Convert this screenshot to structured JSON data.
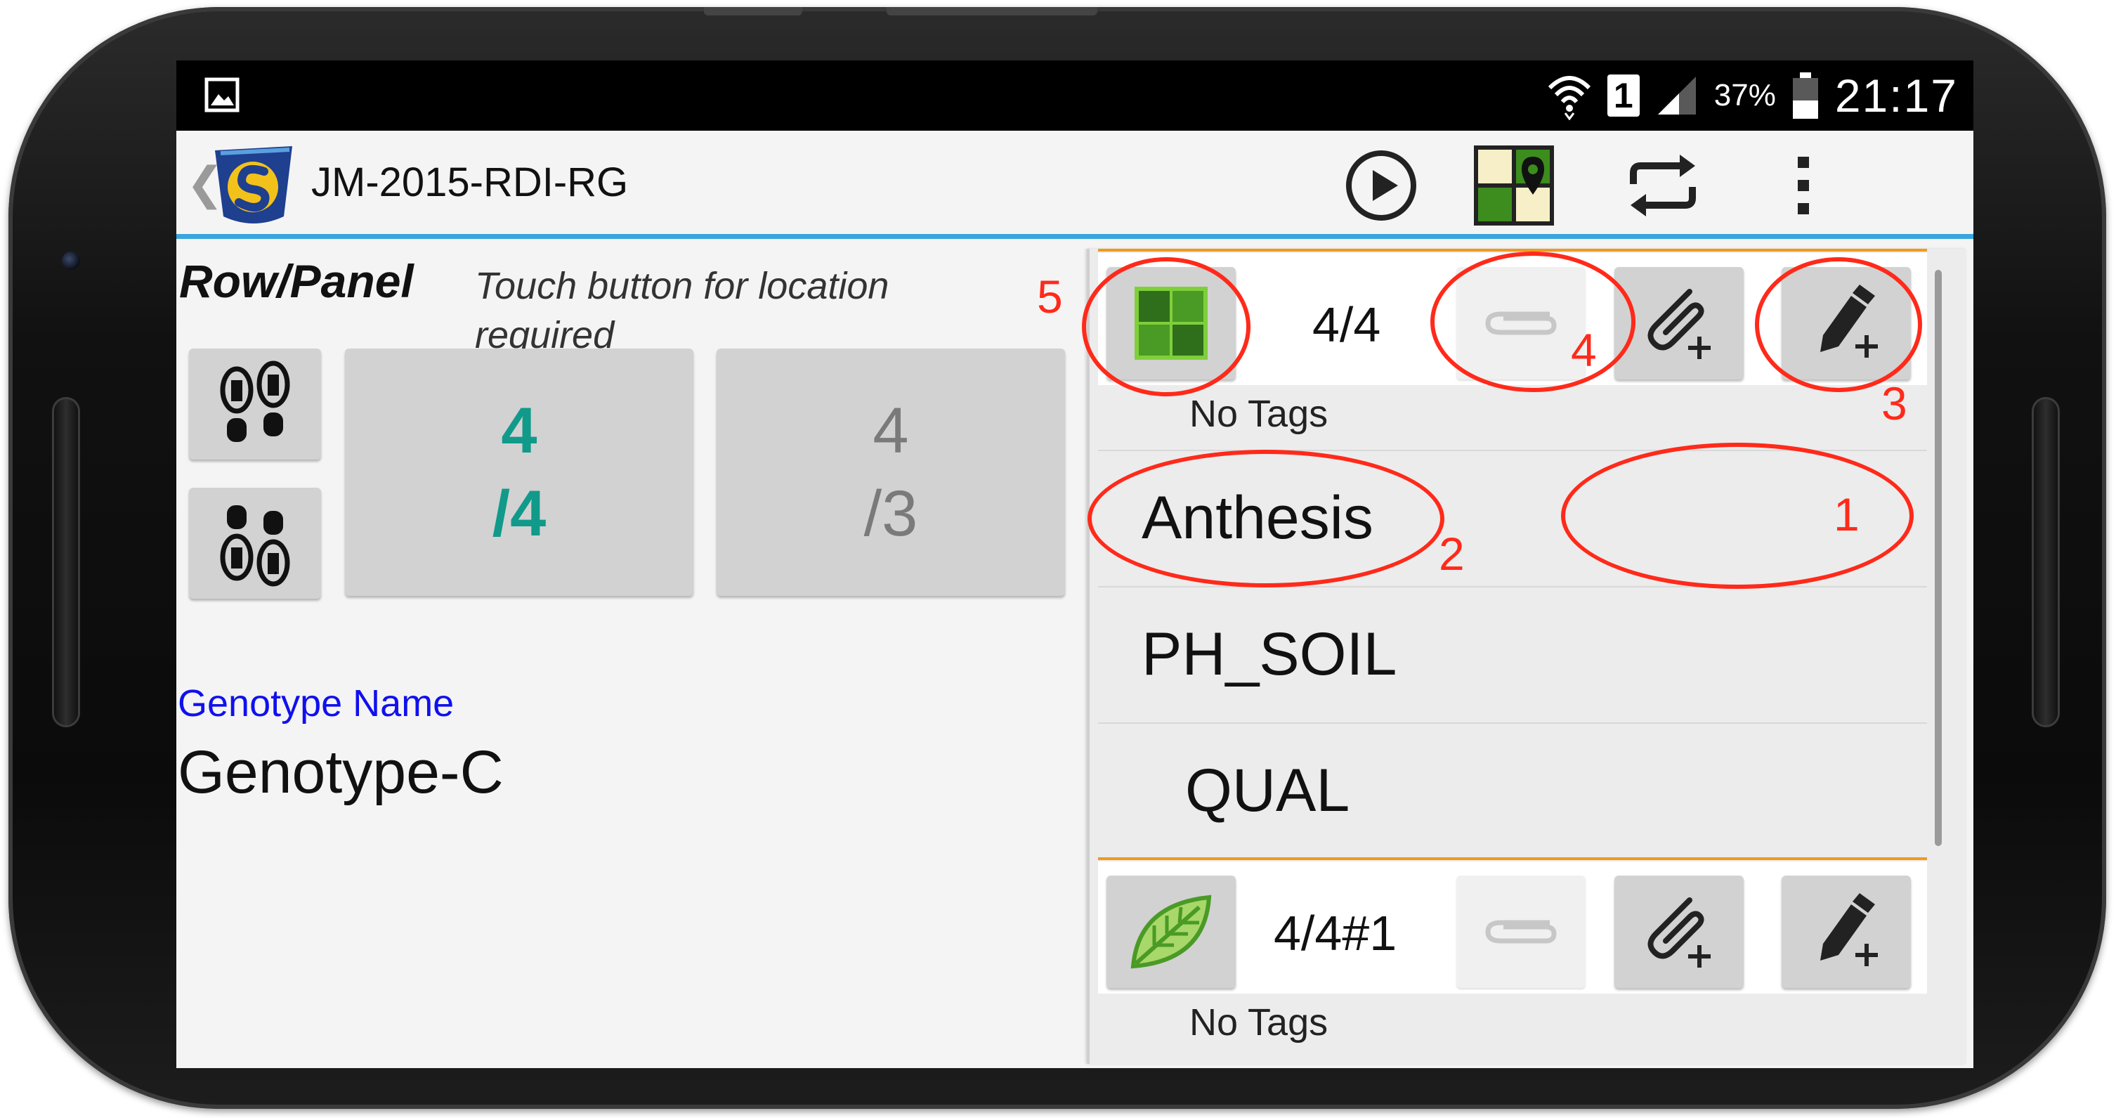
{
  "statusbar": {
    "battery_pct": "37%",
    "time": "21:17",
    "sim_badge": "1"
  },
  "actionbar": {
    "back_glyph": "❮",
    "title": "JM-2015-RDI-RG",
    "actions": [
      "play-icon",
      "field-map-icon",
      "sync-icon",
      "overflow-menu-icon"
    ]
  },
  "location": {
    "label": "Row/Panel",
    "hint": "Touch button for location required",
    "current": {
      "top": "4",
      "bottom": "/4"
    },
    "max": {
      "top": "4",
      "bottom": "/3"
    }
  },
  "genotype": {
    "label": "Genotype Name",
    "value": "Genotype-C"
  },
  "sections": [
    {
      "label": "4/4",
      "tags": "No Tags",
      "icon": "plot-grid-icon"
    },
    {
      "label": "4/4#1",
      "tags": "No Tags",
      "icon": "leaf-icon"
    }
  ],
  "traits": [
    "Anthesis",
    "PH_SOIL",
    "QUAL"
  ],
  "annotations": [
    "1",
    "2",
    "3",
    "4",
    "5"
  ],
  "colors": {
    "accent": "#3aa6de",
    "section_divider": "#f09a1e",
    "current_position": "#119a8a",
    "genotype_label": "#1010ee",
    "annotation": "#ff2a1a"
  }
}
